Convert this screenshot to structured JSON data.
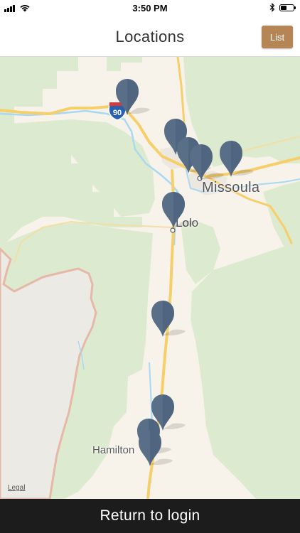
{
  "status_bar": {
    "time": "3:50 PM",
    "battery_level": 0.45
  },
  "nav": {
    "title": "Locations",
    "list_button_label": "List"
  },
  "map": {
    "labels": {
      "missoula": "Missoula",
      "lolo": "Lolo",
      "hamilton": "Hamilton",
      "highway_shield": "90"
    },
    "legal_label": "Legal",
    "marker_color": "#4f6580",
    "water_color": "#a9d8f2",
    "park_color": "#dcebcf",
    "road_color": "#f6cf6a"
  },
  "footer": {
    "return_label": "Return to login"
  }
}
